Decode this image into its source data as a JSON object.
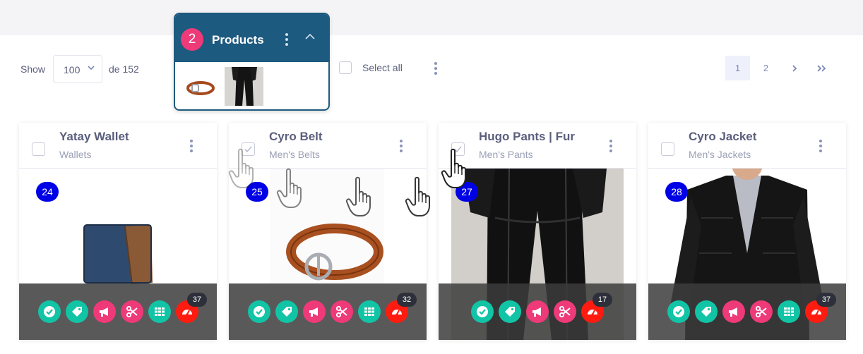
{
  "toolbar": {
    "show_label": "Show",
    "per_page": "100",
    "total_label": "de 152",
    "select_all_label": "Select all"
  },
  "pagination": {
    "pages": [
      "1",
      "2"
    ],
    "current": "1"
  },
  "selection_panel": {
    "count": "2",
    "title": "Products",
    "thumbnails": [
      "belt-thumbnail",
      "pants-thumbnail"
    ]
  },
  "products": [
    {
      "title": "Yatay Wallet",
      "category": "Wallets",
      "number": "24",
      "count": "37",
      "selected": false,
      "actions": [
        "check-icon",
        "tag-icon",
        "megaphone-icon",
        "scissors-icon",
        "grid-icon",
        "speed-icon"
      ]
    },
    {
      "title": "Cyro Belt",
      "category": "Men's Belts",
      "number": "25",
      "count": "32",
      "selected": true,
      "actions": [
        "check-icon",
        "tag-icon",
        "megaphone-icon",
        "scissors-icon",
        "grid-icon",
        "speed-icon"
      ]
    },
    {
      "title": "Hugo Pants | Fur",
      "category": "Men's Pants",
      "number": "27",
      "count": "17",
      "selected": true,
      "actions": [
        "check-icon",
        "tag-icon",
        "megaphone-icon",
        "scissors-icon",
        "speed-icon"
      ]
    },
    {
      "title": "Cyro Jacket",
      "category": "Men's Jackets",
      "number": "28",
      "count": "37",
      "selected": false,
      "actions": [
        "check-icon",
        "tag-icon",
        "megaphone-icon",
        "scissors-icon",
        "grid-icon",
        "speed-icon"
      ]
    }
  ],
  "colors": {
    "header": "#1d5a7f",
    "badge_pink": "#ee3a78",
    "teal": "#12c4a6",
    "pink": "#ee3a78",
    "red": "#ff1b0f",
    "number_badge": "#0000e6",
    "text": "#5a5f7d"
  }
}
